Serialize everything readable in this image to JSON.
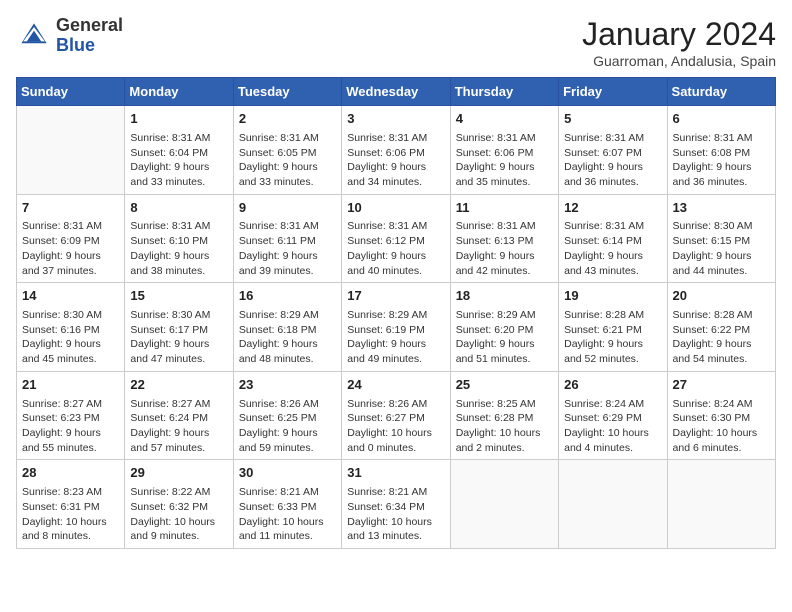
{
  "header": {
    "logo_general": "General",
    "logo_blue": "Blue",
    "month_title": "January 2024",
    "subtitle": "Guarroman, Andalusia, Spain"
  },
  "days_of_week": [
    "Sunday",
    "Monday",
    "Tuesday",
    "Wednesday",
    "Thursday",
    "Friday",
    "Saturday"
  ],
  "weeks": [
    [
      {
        "day": "",
        "info": ""
      },
      {
        "day": "1",
        "info": "Sunrise: 8:31 AM\nSunset: 6:04 PM\nDaylight: 9 hours\nand 33 minutes."
      },
      {
        "day": "2",
        "info": "Sunrise: 8:31 AM\nSunset: 6:05 PM\nDaylight: 9 hours\nand 33 minutes."
      },
      {
        "day": "3",
        "info": "Sunrise: 8:31 AM\nSunset: 6:06 PM\nDaylight: 9 hours\nand 34 minutes."
      },
      {
        "day": "4",
        "info": "Sunrise: 8:31 AM\nSunset: 6:06 PM\nDaylight: 9 hours\nand 35 minutes."
      },
      {
        "day": "5",
        "info": "Sunrise: 8:31 AM\nSunset: 6:07 PM\nDaylight: 9 hours\nand 36 minutes."
      },
      {
        "day": "6",
        "info": "Sunrise: 8:31 AM\nSunset: 6:08 PM\nDaylight: 9 hours\nand 36 minutes."
      }
    ],
    [
      {
        "day": "7",
        "info": "Sunrise: 8:31 AM\nSunset: 6:09 PM\nDaylight: 9 hours\nand 37 minutes."
      },
      {
        "day": "8",
        "info": "Sunrise: 8:31 AM\nSunset: 6:10 PM\nDaylight: 9 hours\nand 38 minutes."
      },
      {
        "day": "9",
        "info": "Sunrise: 8:31 AM\nSunset: 6:11 PM\nDaylight: 9 hours\nand 39 minutes."
      },
      {
        "day": "10",
        "info": "Sunrise: 8:31 AM\nSunset: 6:12 PM\nDaylight: 9 hours\nand 40 minutes."
      },
      {
        "day": "11",
        "info": "Sunrise: 8:31 AM\nSunset: 6:13 PM\nDaylight: 9 hours\nand 42 minutes."
      },
      {
        "day": "12",
        "info": "Sunrise: 8:31 AM\nSunset: 6:14 PM\nDaylight: 9 hours\nand 43 minutes."
      },
      {
        "day": "13",
        "info": "Sunrise: 8:30 AM\nSunset: 6:15 PM\nDaylight: 9 hours\nand 44 minutes."
      }
    ],
    [
      {
        "day": "14",
        "info": "Sunrise: 8:30 AM\nSunset: 6:16 PM\nDaylight: 9 hours\nand 45 minutes."
      },
      {
        "day": "15",
        "info": "Sunrise: 8:30 AM\nSunset: 6:17 PM\nDaylight: 9 hours\nand 47 minutes."
      },
      {
        "day": "16",
        "info": "Sunrise: 8:29 AM\nSunset: 6:18 PM\nDaylight: 9 hours\nand 48 minutes."
      },
      {
        "day": "17",
        "info": "Sunrise: 8:29 AM\nSunset: 6:19 PM\nDaylight: 9 hours\nand 49 minutes."
      },
      {
        "day": "18",
        "info": "Sunrise: 8:29 AM\nSunset: 6:20 PM\nDaylight: 9 hours\nand 51 minutes."
      },
      {
        "day": "19",
        "info": "Sunrise: 8:28 AM\nSunset: 6:21 PM\nDaylight: 9 hours\nand 52 minutes."
      },
      {
        "day": "20",
        "info": "Sunrise: 8:28 AM\nSunset: 6:22 PM\nDaylight: 9 hours\nand 54 minutes."
      }
    ],
    [
      {
        "day": "21",
        "info": "Sunrise: 8:27 AM\nSunset: 6:23 PM\nDaylight: 9 hours\nand 55 minutes."
      },
      {
        "day": "22",
        "info": "Sunrise: 8:27 AM\nSunset: 6:24 PM\nDaylight: 9 hours\nand 57 minutes."
      },
      {
        "day": "23",
        "info": "Sunrise: 8:26 AM\nSunset: 6:25 PM\nDaylight: 9 hours\nand 59 minutes."
      },
      {
        "day": "24",
        "info": "Sunrise: 8:26 AM\nSunset: 6:27 PM\nDaylight: 10 hours\nand 0 minutes."
      },
      {
        "day": "25",
        "info": "Sunrise: 8:25 AM\nSunset: 6:28 PM\nDaylight: 10 hours\nand 2 minutes."
      },
      {
        "day": "26",
        "info": "Sunrise: 8:24 AM\nSunset: 6:29 PM\nDaylight: 10 hours\nand 4 minutes."
      },
      {
        "day": "27",
        "info": "Sunrise: 8:24 AM\nSunset: 6:30 PM\nDaylight: 10 hours\nand 6 minutes."
      }
    ],
    [
      {
        "day": "28",
        "info": "Sunrise: 8:23 AM\nSunset: 6:31 PM\nDaylight: 10 hours\nand 8 minutes."
      },
      {
        "day": "29",
        "info": "Sunrise: 8:22 AM\nSunset: 6:32 PM\nDaylight: 10 hours\nand 9 minutes."
      },
      {
        "day": "30",
        "info": "Sunrise: 8:21 AM\nSunset: 6:33 PM\nDaylight: 10 hours\nand 11 minutes."
      },
      {
        "day": "31",
        "info": "Sunrise: 8:21 AM\nSunset: 6:34 PM\nDaylight: 10 hours\nand 13 minutes."
      },
      {
        "day": "",
        "info": ""
      },
      {
        "day": "",
        "info": ""
      },
      {
        "day": "",
        "info": ""
      }
    ]
  ]
}
